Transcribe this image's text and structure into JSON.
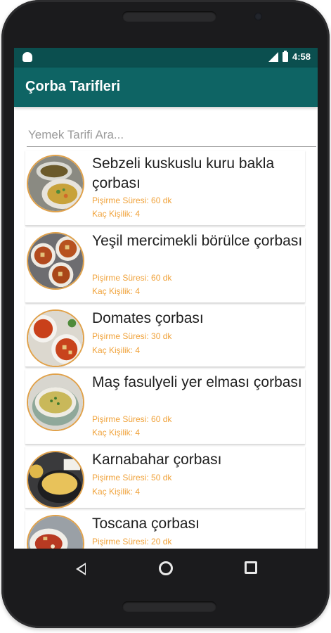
{
  "status_bar": {
    "time": "4:58",
    "left_icon": "android-icon",
    "right_icons": [
      "lte-signal-icon",
      "battery-icon"
    ]
  },
  "app_bar": {
    "title": "Çorba Tarifleri",
    "background": "#0e6464",
    "status_background": "#0b4f4f"
  },
  "search": {
    "placeholder": "Yemek Tarifi Ara...",
    "value": ""
  },
  "recipes": [
    {
      "title": "Sebzeli kuskuslu kuru bakla çorbası",
      "time": "Pişirme Süresi: 60 dk",
      "servings": "Kaç Kişilik: 4"
    },
    {
      "title": "Yeşil mercimekli börülce çorbası",
      "time": "Pişirme Süresi: 60 dk",
      "servings": "Kaç Kişilik: 4"
    },
    {
      "title": "Domates çorbası",
      "time": "Pişirme Süresi: 30 dk",
      "servings": "Kaç Kişilik: 4"
    },
    {
      "title": "Maş fasulyeli yer elması çorbası",
      "time": "Pişirme Süresi: 60 dk",
      "servings": "Kaç Kişilik: 4"
    },
    {
      "title": "Karnabahar çorbası",
      "time": "Pişirme Süresi: 50 dk",
      "servings": "Kaç Kişilik: 4"
    },
    {
      "title": "Toscana çorbası",
      "time": "Pişirme Süresi: 20 dk",
      "servings": ""
    }
  ],
  "colors": {
    "meta_text": "#f0a23a",
    "thumb_border": "#e0a14a"
  },
  "nav_bar": {
    "icons": [
      "back-icon",
      "home-icon",
      "recents-icon"
    ]
  }
}
